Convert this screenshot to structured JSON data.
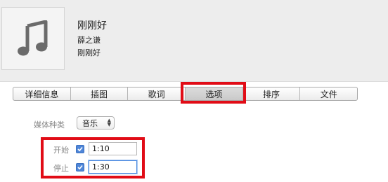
{
  "song": {
    "title": "刚刚好",
    "artist": "薛之谦",
    "album": "刚刚好",
    "artwork_icon": "music-note-icon"
  },
  "tabs": [
    {
      "label": "详细信息"
    },
    {
      "label": "插图"
    },
    {
      "label": "歌词"
    },
    {
      "label": "选项",
      "active": true
    },
    {
      "label": "排序"
    },
    {
      "label": "文件"
    }
  ],
  "options": {
    "media_kind_label": "媒体种类",
    "media_kind_value": "音乐",
    "start": {
      "label": "开始",
      "checked": true,
      "value": "1:10"
    },
    "stop": {
      "label": "停止",
      "checked": true,
      "value": "1:30"
    }
  },
  "colors": {
    "highlight_box": "#e10c16",
    "checkbox": "#4f86d8"
  }
}
